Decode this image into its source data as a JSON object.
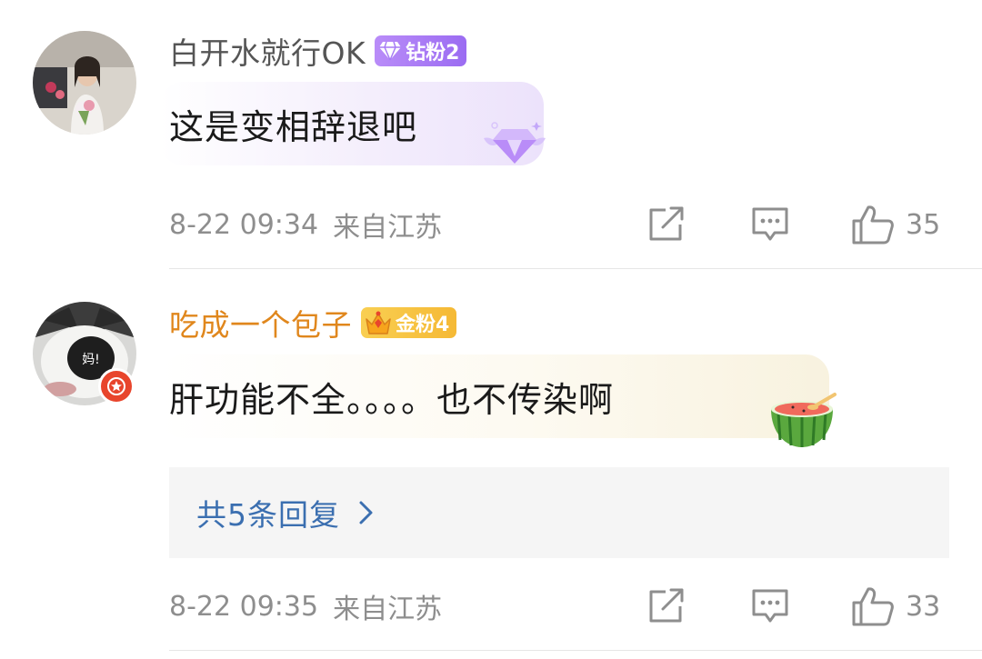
{
  "comments": [
    {
      "username": "白开水就行OK",
      "fan_badge": "钻粉2",
      "text": "这是变相辞退吧",
      "timestamp": "8-22 09:34",
      "location": "来自江苏",
      "likes": "35"
    },
    {
      "username": "吃成一个包子",
      "fan_badge": "金粉4",
      "text": "肝功能不全。。。。也不传染啊",
      "avatar_text": "妈!",
      "timestamp": "8-22 09:35",
      "location": "来自江苏",
      "likes": "33",
      "replies_label": "共5条回复"
    }
  ],
  "colors": {
    "username_gray": "#555555",
    "username_gold": "#e0871d",
    "meta_gray": "#8e8e8e",
    "link_blue": "#3b6fb0",
    "diamond_badge": "#a77cf5",
    "gold_badge": "#f5bd3a"
  },
  "icons": [
    "share-icon",
    "comment-icon",
    "like-icon",
    "chevron-right-icon",
    "diamond-icon",
    "crown-icon",
    "watermelon-icon",
    "star-badge-icon"
  ]
}
